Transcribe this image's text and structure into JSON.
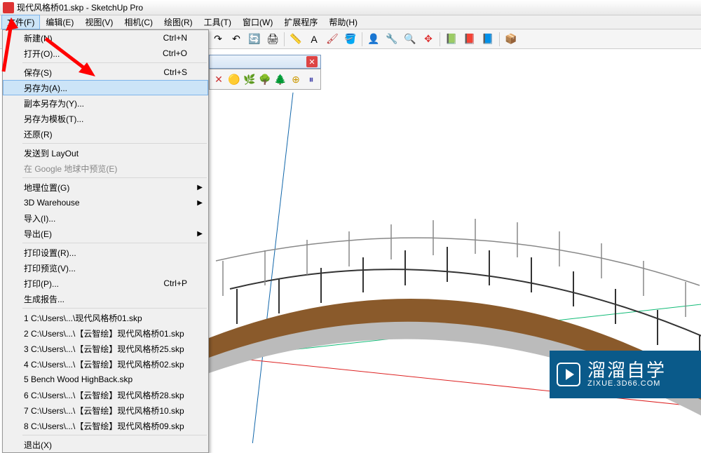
{
  "window": {
    "title": "现代风格桥01.skp - SketchUp Pro"
  },
  "menu": {
    "items": [
      "文件(F)",
      "编辑(E)",
      "视图(V)",
      "相机(C)",
      "绘图(R)",
      "工具(T)",
      "窗口(W)",
      "扩展程序",
      "帮助(H)"
    ],
    "active_index": 0
  },
  "file_menu": {
    "group1": [
      {
        "label": "新建(N)",
        "shortcut": "Ctrl+N"
      },
      {
        "label": "打开(O)...",
        "shortcut": "Ctrl+O"
      }
    ],
    "group2": [
      {
        "label": "保存(S)",
        "shortcut": "Ctrl+S"
      },
      {
        "label": "另存为(A)...",
        "shortcut": "",
        "highlight": true
      },
      {
        "label": "副本另存为(Y)...",
        "shortcut": ""
      },
      {
        "label": "另存为模板(T)...",
        "shortcut": ""
      },
      {
        "label": "还原(R)",
        "shortcut": ""
      }
    ],
    "group3": [
      {
        "label": "发送到 LayOut",
        "shortcut": ""
      },
      {
        "label": "在 Google 地球中预览(E)",
        "shortcut": "",
        "disabled": true
      }
    ],
    "group4": [
      {
        "label": "地理位置(G)",
        "submenu": true
      },
      {
        "label": "3D Warehouse",
        "submenu": true
      },
      {
        "label": "导入(I)...",
        "shortcut": ""
      },
      {
        "label": "导出(E)",
        "submenu": true
      }
    ],
    "group5": [
      {
        "label": "打印设置(R)...",
        "shortcut": ""
      },
      {
        "label": "打印预览(V)...",
        "shortcut": ""
      },
      {
        "label": "打印(P)...",
        "shortcut": "Ctrl+P"
      },
      {
        "label": "生成报告...",
        "shortcut": ""
      }
    ],
    "recent": [
      "1 C:\\Users\\...\\现代风格桥01.skp",
      "2 C:\\Users\\...\\【云智绘】现代风格桥01.skp",
      "3 C:\\Users\\...\\【云智绘】现代风格桥25.skp",
      "4 C:\\Users\\...\\【云智绘】现代风格桥02.skp",
      "5 Bench Wood HighBack.skp",
      "6 C:\\Users\\...\\【云智绘】现代风格桥28.skp",
      "7 C:\\Users\\...\\【云智绘】现代风格桥10.skp",
      "8 C:\\Users\\...\\【云智绘】现代风格桥09.skp"
    ],
    "exit": {
      "label": "退出(X)"
    }
  },
  "toolbar_icons": {
    "row1": [
      "↷",
      "↶",
      "🔄",
      "🖨",
      "|",
      "📏",
      "A",
      "🖌",
      "🪣",
      "|",
      "👤",
      "🔧",
      "🔍",
      "✥",
      "|",
      "📗",
      "📕",
      "📘",
      "|",
      "📦"
    ],
    "small": [
      "✕",
      "🟡",
      "🌿",
      "🌳",
      "🌲",
      "⊕",
      "⏸"
    ]
  },
  "watermark": {
    "big": "溜溜自学",
    "small": "ZIXUE.3D66.COM"
  },
  "colors": {
    "accent": "#0a5a8a",
    "highlight": "#cce4f7",
    "arrow": "#ff0000"
  }
}
